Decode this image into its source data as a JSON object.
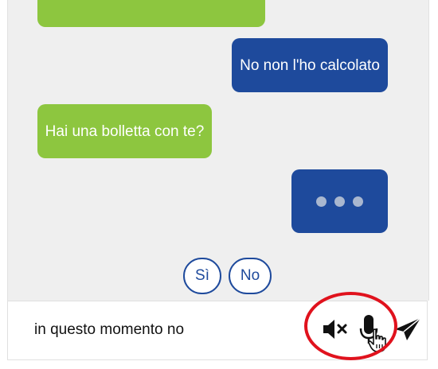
{
  "messages": [
    {
      "role": "bot",
      "text": ""
    },
    {
      "role": "user",
      "text": "No non l'ho calcolato"
    },
    {
      "role": "bot",
      "text": "Hai una bolletta con te?"
    },
    {
      "role": "user",
      "typing": true
    }
  ],
  "quick_replies": [
    {
      "label": "Sì"
    },
    {
      "label": "No"
    }
  ],
  "input": {
    "value": "in questo momento no"
  },
  "icons": {
    "mute": "speaker-mute-icon",
    "mic": "microphone-icon",
    "send": "send-icon",
    "cursor": "hand-cursor-icon"
  },
  "colors": {
    "bot_bubble": "#8dc63f",
    "user_bubble": "#1e4a9c",
    "chat_background": "#efefef",
    "highlight": "#e0121d"
  }
}
